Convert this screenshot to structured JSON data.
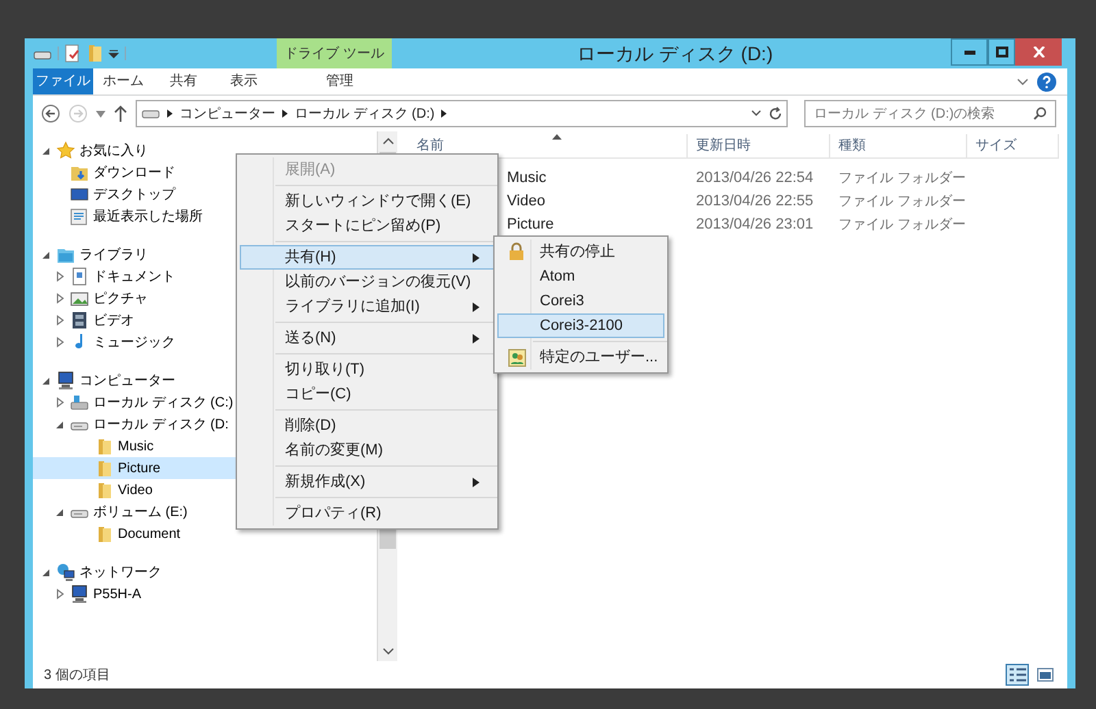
{
  "window": {
    "title": "ローカル ディスク (D:)",
    "contextual_group": "ドライブ ツール"
  },
  "ribbon_tabs": [
    {
      "label": "ファイル",
      "kind": "file",
      "selected": false
    },
    {
      "label": "ホーム",
      "kind": "tab",
      "selected": false
    },
    {
      "label": "共有",
      "kind": "tab",
      "selected": false
    },
    {
      "label": "表示",
      "kind": "tab",
      "selected": false
    },
    {
      "label": "管理",
      "kind": "contextual",
      "selected": false
    }
  ],
  "address_bar": {
    "breadcrumbs": [
      "コンピューター",
      "ローカル ディスク (D:)"
    ]
  },
  "search": {
    "placeholder": "ローカル ディスク (D:)の検索"
  },
  "navigation": [
    {
      "label": "お気に入り",
      "kind": "star",
      "expandable": true,
      "expanded": true,
      "selected": false,
      "children": [
        {
          "label": "ダウンロード",
          "kind": "download",
          "expandable": false,
          "selected": false
        },
        {
          "label": "デスクトップ",
          "kind": "desktop",
          "expandable": false,
          "selected": false
        },
        {
          "label": "最近表示した場所",
          "kind": "recent",
          "expandable": false,
          "selected": false
        }
      ]
    },
    {
      "label": "ライブラリ",
      "kind": "library",
      "expandable": true,
      "expanded": true,
      "selected": false,
      "children": [
        {
          "label": "ドキュメント",
          "kind": "document",
          "expandable": true,
          "expanded": false,
          "selected": false
        },
        {
          "label": "ピクチャ",
          "kind": "picture",
          "expandable": true,
          "expanded": false,
          "selected": false
        },
        {
          "label": "ビデオ",
          "kind": "video",
          "expandable": true,
          "expanded": false,
          "selected": false
        },
        {
          "label": "ミュージック",
          "kind": "music",
          "expandable": true,
          "expanded": false,
          "selected": false
        }
      ]
    },
    {
      "label": "コンピューター",
      "kind": "computer",
      "expandable": true,
      "expanded": true,
      "selected": false,
      "children": [
        {
          "label": "ローカル ディスク (C:)",
          "kind": "system-drive",
          "expandable": true,
          "expanded": false,
          "selected": false
        },
        {
          "label": "ローカル ディスク (D:",
          "kind": "drive",
          "expandable": true,
          "expanded": true,
          "selected": false,
          "children": [
            {
              "label": "Music",
              "kind": "folder",
              "expandable": false,
              "selected": false
            },
            {
              "label": "Picture",
              "kind": "folder",
              "expandable": false,
              "selected": true
            },
            {
              "label": "Video",
              "kind": "folder",
              "expandable": false,
              "selected": false
            }
          ]
        },
        {
          "label": "ボリューム (E:)",
          "kind": "drive",
          "expandable": true,
          "expanded": true,
          "selected": false,
          "children": [
            {
              "label": "Document",
              "kind": "folder",
              "expandable": false,
              "selected": false
            }
          ]
        }
      ]
    },
    {
      "label": "ネットワーク",
      "kind": "network",
      "expandable": true,
      "expanded": true,
      "selected": false,
      "children": [
        {
          "label": "P55H-A",
          "kind": "computer",
          "expandable": true,
          "expanded": false,
          "selected": false
        }
      ]
    }
  ],
  "file_list": {
    "columns": [
      "名前",
      "更新日時",
      "種類",
      "サイズ"
    ],
    "rows": [
      {
        "name": "Music",
        "modified": "2013/04/26 22:54",
        "type": "ファイル フォルダー"
      },
      {
        "name": "Video",
        "modified": "2013/04/26 22:55",
        "type": "ファイル フォルダー"
      },
      {
        "name": "Picture",
        "modified": "2013/04/26 23:01",
        "type": "ファイル フォルダー"
      }
    ]
  },
  "context_menu": [
    {
      "kind": "item",
      "label": "展開(A)",
      "disabled": true,
      "selected": false,
      "submenu": false
    },
    {
      "kind": "separator"
    },
    {
      "kind": "item",
      "label": "新しいウィンドウで開く(E)",
      "disabled": false,
      "selected": false,
      "submenu": false
    },
    {
      "kind": "item",
      "label": "スタートにピン留め(P)",
      "disabled": false,
      "selected": false,
      "submenu": false
    },
    {
      "kind": "separator"
    },
    {
      "kind": "item",
      "label": "共有(H)",
      "disabled": false,
      "selected": true,
      "submenu": true
    },
    {
      "kind": "item",
      "label": "以前のバージョンの復元(V)",
      "disabled": false,
      "selected": false,
      "submenu": false
    },
    {
      "kind": "item",
      "label": "ライブラリに追加(I)",
      "disabled": false,
      "selected": false,
      "submenu": true
    },
    {
      "kind": "separator"
    },
    {
      "kind": "item",
      "label": "送る(N)",
      "disabled": false,
      "selected": false,
      "submenu": true
    },
    {
      "kind": "separator"
    },
    {
      "kind": "item",
      "label": "切り取り(T)",
      "disabled": false,
      "selected": false,
      "submenu": false
    },
    {
      "kind": "item",
      "label": "コピー(C)",
      "disabled": false,
      "selected": false,
      "submenu": false
    },
    {
      "kind": "separator"
    },
    {
      "kind": "item",
      "label": "削除(D)",
      "disabled": false,
      "selected": false,
      "submenu": false
    },
    {
      "kind": "item",
      "label": "名前の変更(M)",
      "disabled": false,
      "selected": false,
      "submenu": false
    },
    {
      "kind": "separator"
    },
    {
      "kind": "item",
      "label": "新規作成(X)",
      "disabled": false,
      "selected": false,
      "submenu": true
    },
    {
      "kind": "separator"
    },
    {
      "kind": "item",
      "label": "プロパティ(R)",
      "disabled": false,
      "selected": false,
      "submenu": false
    }
  ],
  "share_submenu": [
    {
      "kind": "lock",
      "label": "共有の停止",
      "selected": false
    },
    {
      "kind": "plain",
      "label": "Atom",
      "selected": false
    },
    {
      "kind": "plain",
      "label": "Corei3",
      "selected": false
    },
    {
      "kind": "plain",
      "label": "Corei3-2100",
      "selected": true
    },
    {
      "kind": "separator"
    },
    {
      "kind": "users",
      "label": "特定のユーザー...",
      "selected": false
    }
  ],
  "status_bar": {
    "text": "3 個の項目",
    "views": [
      {
        "kind": "details",
        "selected": true
      },
      {
        "kind": "large-icons",
        "selected": false
      }
    ]
  }
}
